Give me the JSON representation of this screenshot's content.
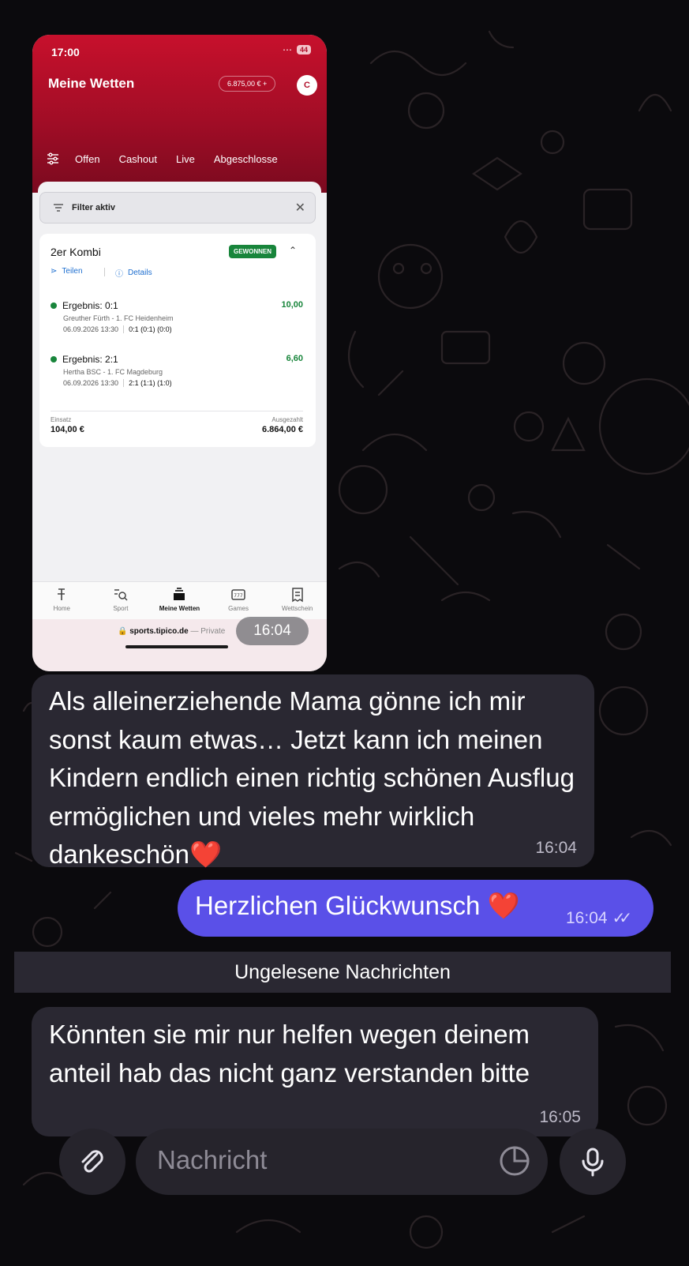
{
  "screenshot": {
    "status_time": "17:00",
    "battery": "44",
    "app_title": "Meine Wetten",
    "balance": "6.875,00 € +",
    "avatar_initial": "C",
    "tabs": [
      "Offen",
      "Cashout",
      "Live",
      "Abgeschlosse"
    ],
    "filter_label": "Filter aktiv",
    "bet": {
      "type": "2er Kombi",
      "status": "GEWONNEN",
      "share_label": "Teilen",
      "details_label": "Details",
      "selections": [
        {
          "market": "Ergebnis: 0:1",
          "odds": "10,00",
          "teams": "Greuther Fürth - 1. FC Heidenheim",
          "datetime": "06.09.2026 13:30",
          "score": "0:1 (0:1) (0:0)"
        },
        {
          "market": "Ergebnis: 2:1",
          "odds": "6,60",
          "teams": "Hertha BSC - 1. FC Magdeburg",
          "datetime": "06.09.2026 13:30",
          "score": "2:1 (1:1) (1:0)"
        }
      ],
      "stake_label": "Einsatz",
      "stake": "104,00 €",
      "payout_label": "Ausgezahlt",
      "payout": "6.864,00 €"
    },
    "nav": [
      "Home",
      "Sport",
      "Meine Wetten",
      "Games",
      "Wettschein"
    ],
    "url": "sports.tipico.de",
    "url_suffix": "— Private",
    "image_time": "16:04"
  },
  "messages": [
    {
      "direction": "incoming",
      "text": "Als alleinerziehende Mama gönne ich mir sonst kaum etwas… Jetzt kann ich meinen Kindern endlich einen richtig schönen Ausflug ermöglichen und vieles mehr wirklich dankeschön❤️",
      "time": "16:04"
    },
    {
      "direction": "outgoing",
      "text": "Herzlichen Glückwunsch ❤️",
      "time": "16:04"
    },
    {
      "direction": "incoming",
      "text": "Könnten sie mir nur helfen wegen deinem anteil hab das nicht ganz verstanden bitte",
      "time": "16:05"
    }
  ],
  "unread_divider": "Ungelesene Nachrichten",
  "composer": {
    "placeholder": "Nachricht"
  },
  "colors": {
    "background": "#0b0a0d",
    "incoming_bubble": "#2a2832",
    "outgoing_bubble": "#5a50e8",
    "tipico_red": "#c7102c",
    "won_green": "#18853b"
  },
  "icons": [
    "attach-icon",
    "sticker-icon",
    "mic-icon",
    "read-ticks-icon"
  ]
}
